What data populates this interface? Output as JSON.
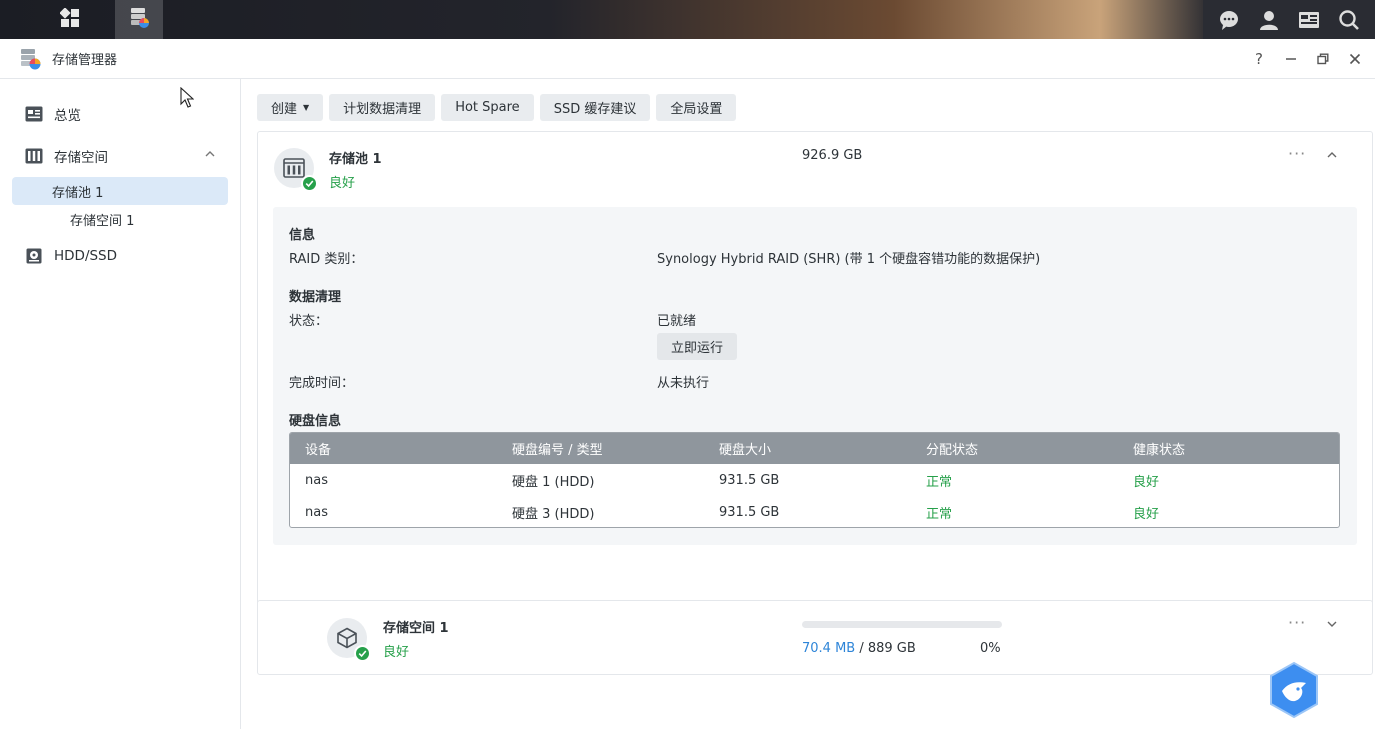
{
  "window": {
    "title": "存储管理器"
  },
  "sidebar": {
    "overview": "总览",
    "storage": "存储空间",
    "pool": "存储池 1",
    "volume": "存储空间 1",
    "hdd": "HDD/SSD"
  },
  "toolbar": {
    "create": "创建",
    "scrub": "计划数据清理",
    "hotspare": "Hot Spare",
    "ssd": "SSD 缓存建议",
    "global": "全局设置"
  },
  "pool": {
    "name": "存储池 1",
    "status": "良好",
    "size": "926.9 GB",
    "info": {
      "section_title": "信息",
      "raid_label": "RAID 类别：",
      "raid_value": "Synology Hybrid RAID (SHR) (带 1 个硬盘容错功能的数据保护)"
    },
    "scrub": {
      "section_title": "数据清理",
      "status_label": "状态：",
      "status_value": "已就绪",
      "run_now": "立即运行",
      "completed_label": "完成时间：",
      "completed_value": "从未执行"
    },
    "disks": {
      "section_title": "硬盘信息",
      "headers": [
        "设备",
        "硬盘编号 / 类型",
        "硬盘大小",
        "分配状态",
        "健康状态"
      ],
      "rows": [
        [
          "nas",
          "硬盘 1 (HDD)",
          "931.5 GB",
          "正常",
          "良好"
        ],
        [
          "nas",
          "硬盘 3 (HDD)",
          "931.5 GB",
          "正常",
          "良好"
        ]
      ]
    }
  },
  "volume": {
    "name": "存储空间 1",
    "status": "良好",
    "used": "70.4 MB",
    "total_sep": " / 889 GB",
    "percent": "0%",
    "percent_value": 0
  },
  "colors": {
    "accent": "#2e85d8",
    "good": "#26a04a",
    "selected": "#dbe9f8"
  }
}
